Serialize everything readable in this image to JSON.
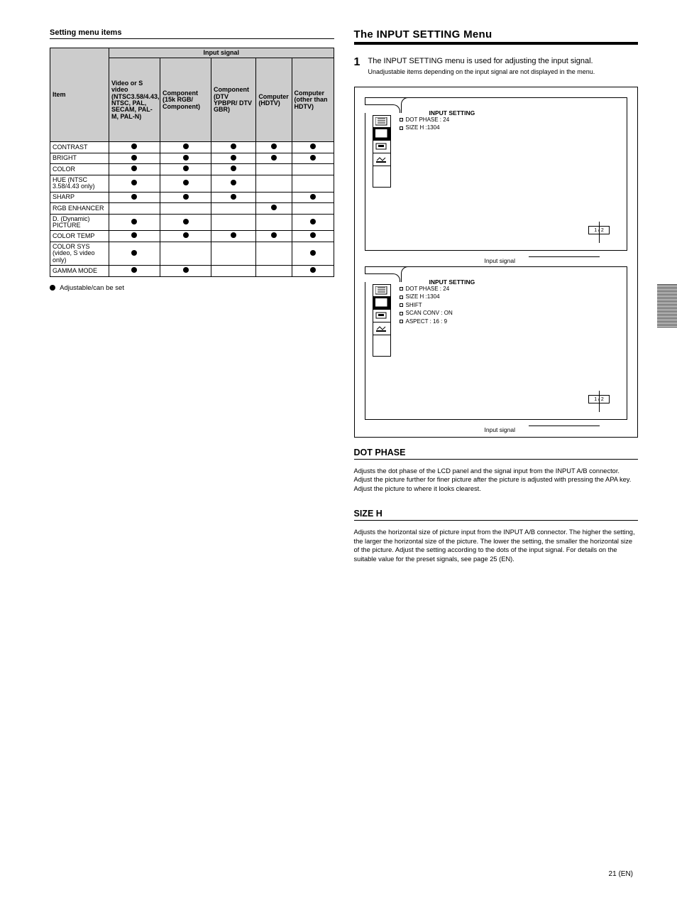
{
  "left": {
    "heading": "Setting menu items",
    "table": {
      "corner": "Item",
      "super_header": "Input signal",
      "col_headers": [
        "Video or S video (NTSC3.58/4.43, NTSC, PAL, SECAM, PAL-M, PAL-N)",
        "Component (15k RGB/ Component)",
        "Component (DTV YPBPR/ DTV GBR)",
        "Computer (HDTV)",
        "Computer (other than HDTV)"
      ],
      "rows": [
        {
          "label": "CONTRAST",
          "marks": [
            true,
            true,
            true,
            true,
            true
          ]
        },
        {
          "label": "BRIGHT",
          "marks": [
            true,
            true,
            true,
            true,
            true
          ]
        },
        {
          "label": "COLOR",
          "marks": [
            true,
            true,
            true,
            false,
            false
          ]
        },
        {
          "label": "HUE (NTSC 3.58/4.43 only)",
          "marks": [
            true,
            true,
            true,
            false,
            false
          ]
        },
        {
          "label": "SHARP",
          "marks": [
            true,
            true,
            true,
            false,
            true
          ]
        },
        {
          "label": "RGB ENHANCER",
          "marks": [
            false,
            false,
            false,
            true,
            false
          ]
        },
        {
          "label": "D. (Dynamic) PICTURE",
          "marks": [
            true,
            true,
            false,
            false,
            true
          ]
        },
        {
          "label": "COLOR TEMP",
          "marks": [
            true,
            true,
            true,
            true,
            true
          ]
        },
        {
          "label": "COLOR SYS (video, S video only)",
          "marks": [
            true,
            false,
            false,
            false,
            true
          ]
        },
        {
          "label": "GAMMA MODE",
          "marks": [
            true,
            true,
            false,
            false,
            true
          ]
        }
      ]
    },
    "legend": "Adjustable/can be set"
  },
  "right": {
    "heading": "The INPUT SETTING Menu",
    "step_num": "1",
    "step_text": "The INPUT SETTING menu is used for adjusting the input signal.",
    "step_sub": "Unadjustable items depending on the input signal are not displayed in the menu.",
    "panel1": {
      "title": "INPUT SETTING",
      "items": [
        "DOT PHASE : 24",
        "SIZE H :1304"
      ],
      "caption": "Input signal"
    },
    "panel2": {
      "title": "INPUT SETTING",
      "items": [
        "DOT PHASE : 24",
        "SIZE H :1304",
        "SHIFT",
        "SCAN CONV : ON",
        "ASPECT : 16 : 9"
      ],
      "caption": "Input signal"
    },
    "sections": [
      {
        "heading": "DOT PHASE",
        "body": "Adjusts the dot phase of the LCD panel and the signal input from the INPUT A/B connector. Adjust the picture further for finer picture after the picture is adjusted with pressing the APA key. Adjust the picture to where it looks clearest."
      },
      {
        "heading": "SIZE H",
        "body": "Adjusts the horizontal size of picture input from the INPUT A/B connector. The higher the setting, the larger the horizontal size of the picture. The lower the setting, the smaller the horizontal size of the picture. Adjust the setting according to the dots of the input signal. For details on the suitable value for the preset signals, see page 25 (EN)."
      }
    ]
  },
  "page_number": "21 (EN)",
  "page_ind": "1 / 2"
}
